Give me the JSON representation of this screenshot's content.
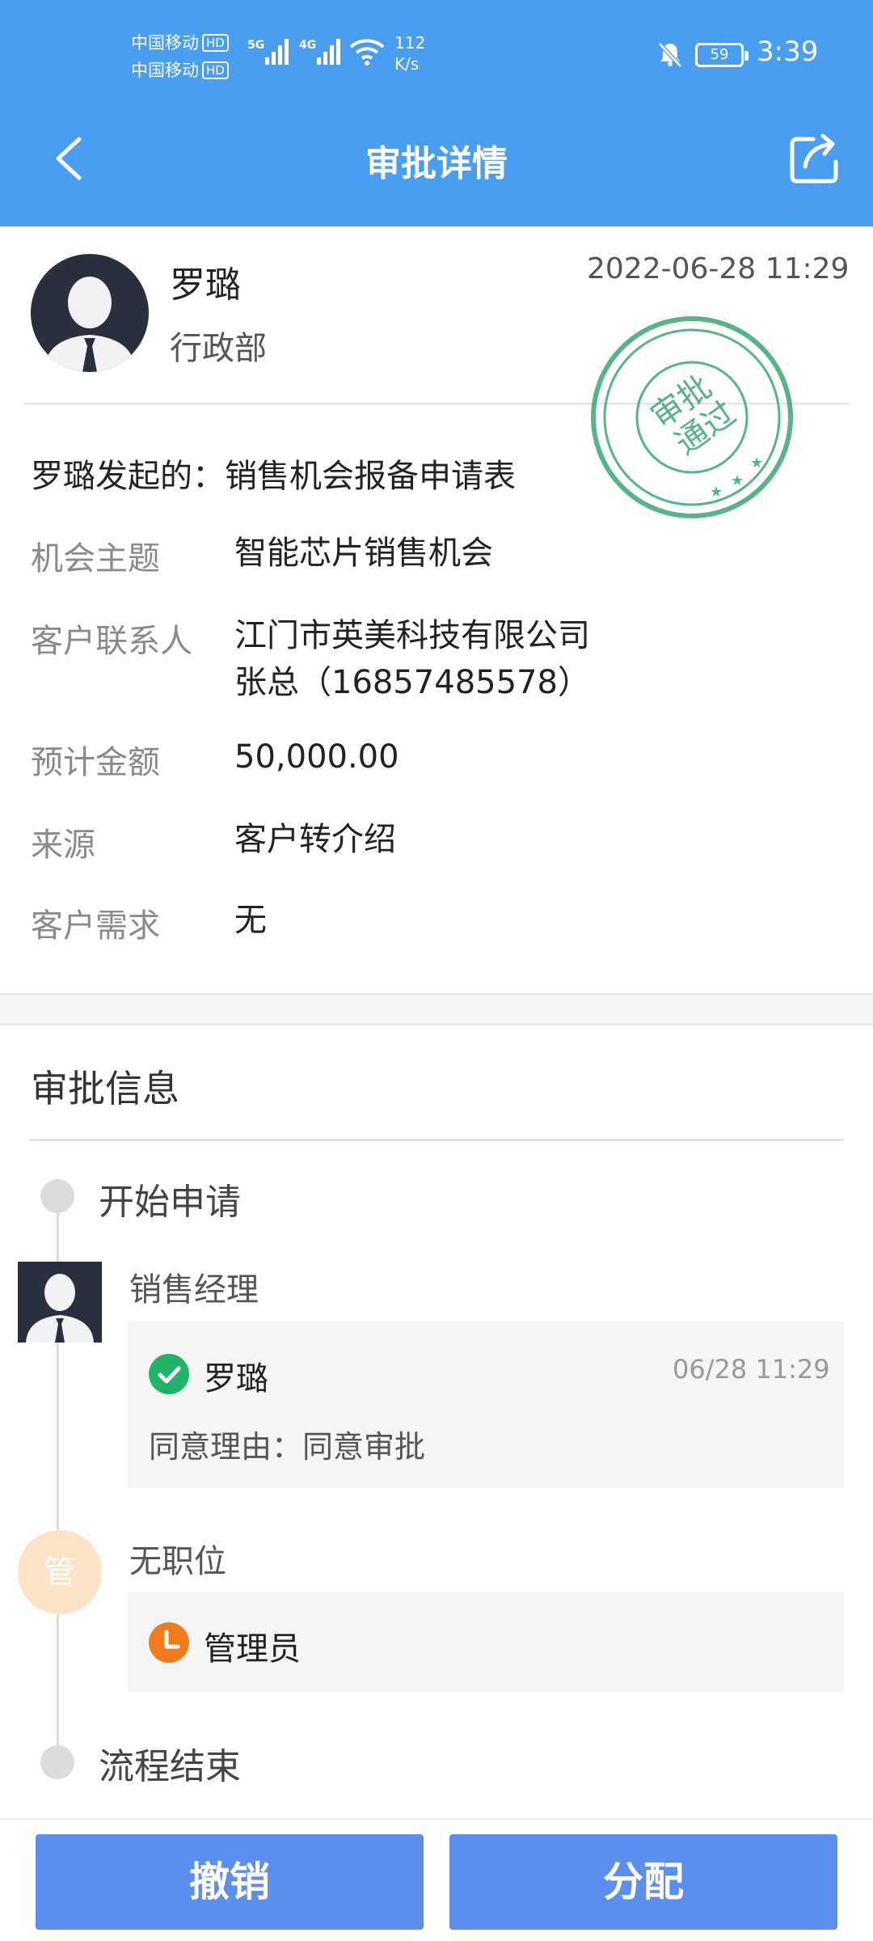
{
  "status_bar": {
    "carrier1": "中国移动",
    "carrier2": "中国移动",
    "hd": "HD",
    "gen1": "5G",
    "gen2": "4G",
    "speed_value": "112",
    "speed_unit": "K/s",
    "battery": "59",
    "time": "3:39"
  },
  "header": {
    "title": "审批详情",
    "back_icon": "chevron-left-icon",
    "share_icon": "share-icon",
    "background": "#4a9ef2"
  },
  "applicant": {
    "name": "罗璐",
    "department": "行政部",
    "created_at": "2022-06-28 11:29"
  },
  "stamp": {
    "text_line1": "审批",
    "text_line2": "通过",
    "color": "#3aa775"
  },
  "form": {
    "title": "罗璐发起的：销售机会报备申请表",
    "rows": [
      {
        "label": "机会主题",
        "value": "智能芯片销售机会"
      },
      {
        "label": "客户联系人",
        "value": "江门市英美科技有限公司",
        "value2": "张总（16857485578）"
      },
      {
        "label": "预计金额",
        "value": "50,000.00"
      },
      {
        "label": "来源",
        "value": "客户转介绍"
      },
      {
        "label": "客户需求",
        "value": "无"
      }
    ]
  },
  "approval": {
    "section_title": "审批信息",
    "start": "开始申请",
    "nodes": [
      {
        "title": "销售经理",
        "approver": "罗璐",
        "time": "06/28 11:29",
        "reason": "同意理由：同意审批",
        "status_icon": "check-circle-icon",
        "status_color": "#1fb46a"
      },
      {
        "title": "无职位",
        "badge": "管",
        "approver": "管理员",
        "status_icon": "clock-icon",
        "status_color": "#f07b1c"
      }
    ],
    "end": "流程结束"
  },
  "actions": {
    "revoke": "撤销",
    "assign": "分配",
    "button_color": "#5a8fef"
  }
}
